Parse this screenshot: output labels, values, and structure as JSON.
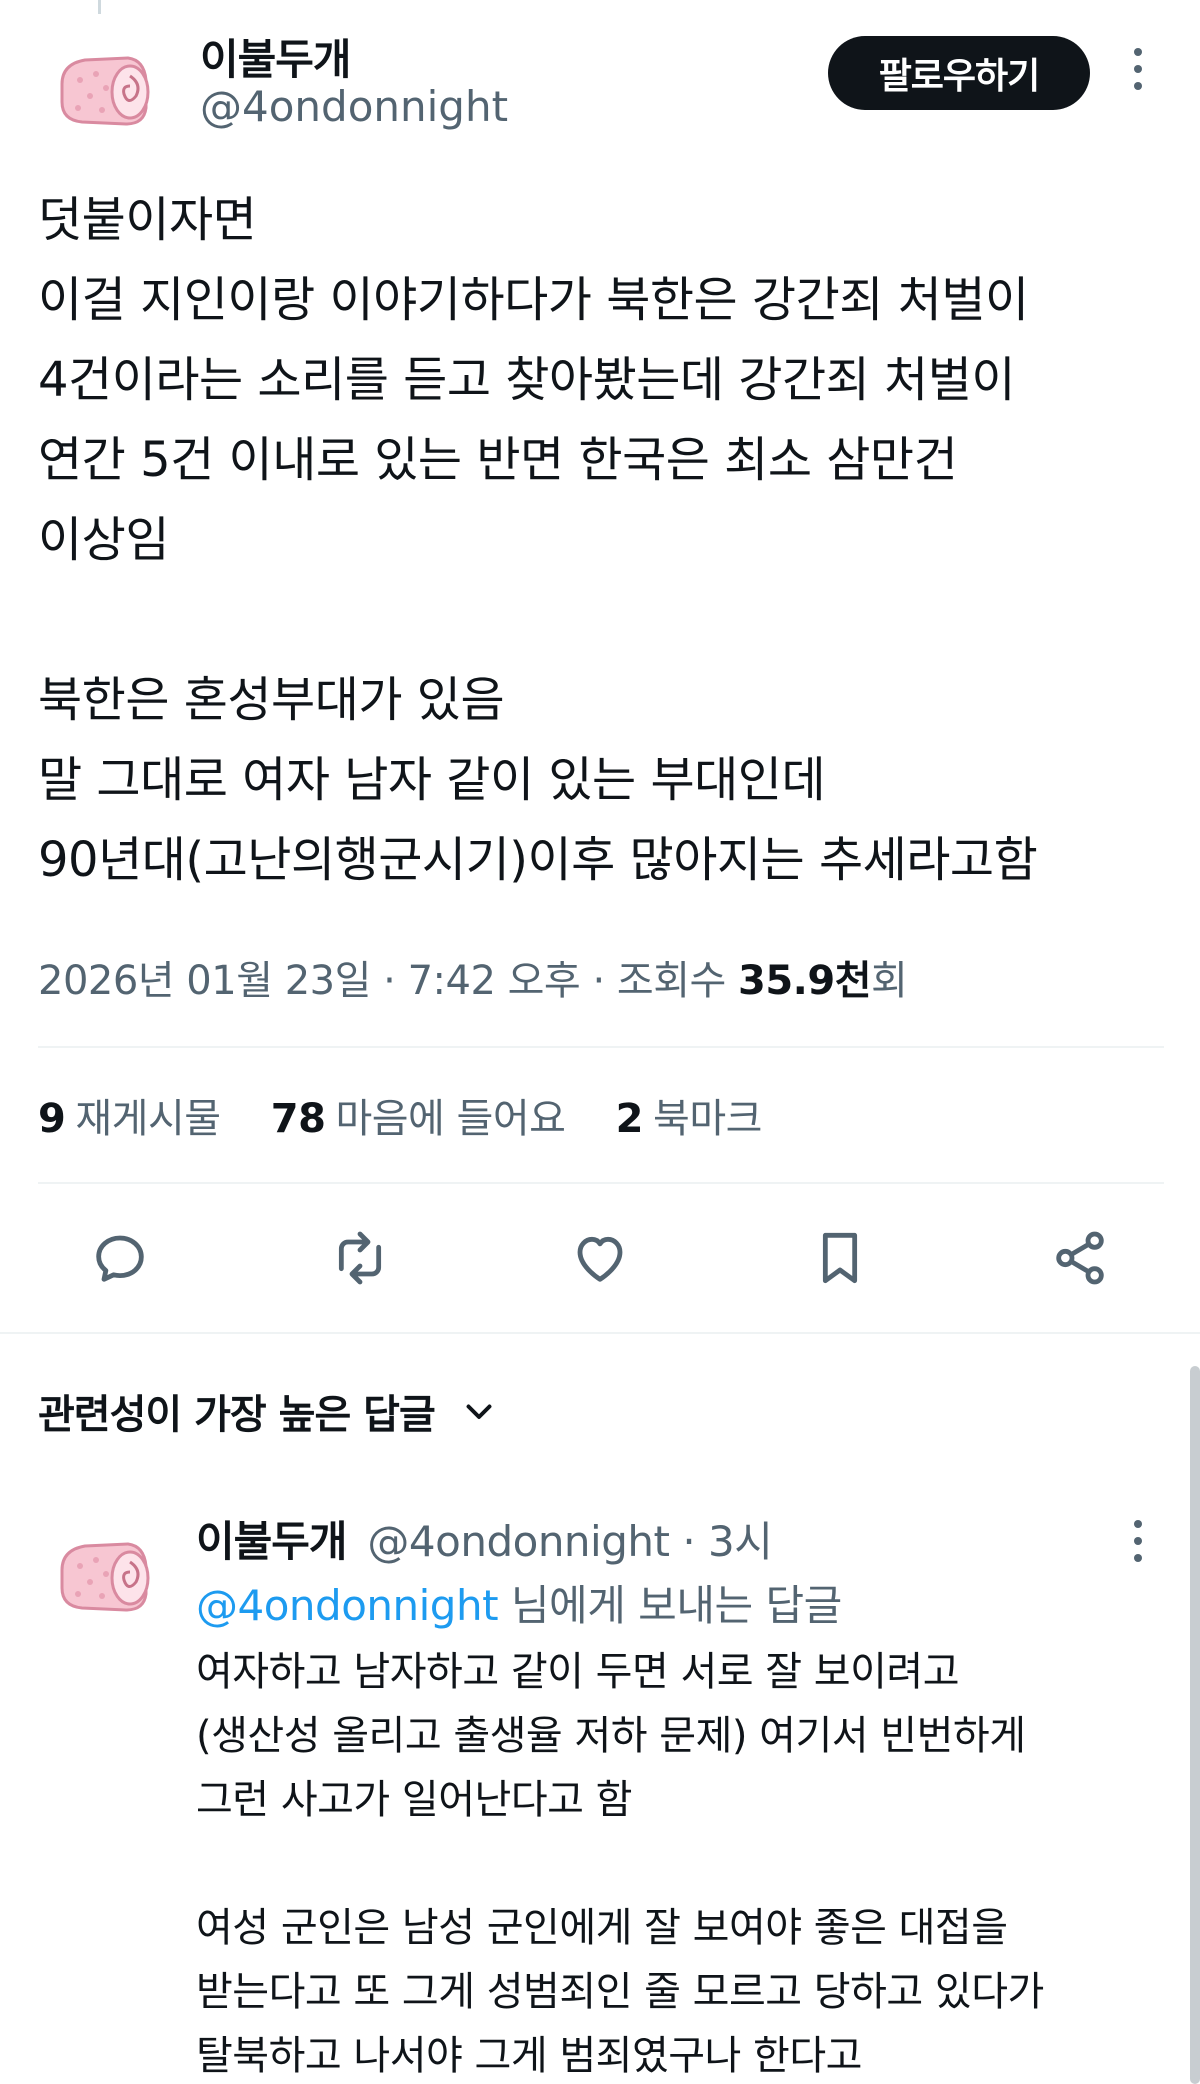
{
  "tweet": {
    "author": {
      "name": "이불두개",
      "handle": "@4ondonnight"
    },
    "follow_label": "팔로우하기",
    "lines": [
      "덧붙이자면",
      "이걸 지인이랑 이야기하다가 북한은 강간죄 처벌이",
      "4건이라는 소리를 듣고 찾아봤는데 강간죄 처벌이",
      "연간 5건 이내로 있는 반면 한국은 최소 삼만건",
      "이상임",
      "",
      "북한은 혼성부대가 있음",
      "말 그대로 여자 남자 같이 있는 부대인데",
      "90년대(고난의행군시기)이후 많아지는 추세라고함"
    ],
    "date": "2026년 01월 23일",
    "time": "7:42 오후",
    "views_label": "조회수",
    "views_value": "35.9천",
    "views_suffix": "회",
    "separator": " · "
  },
  "stats": [
    {
      "count": "9",
      "label": "재게시물"
    },
    {
      "count": "78",
      "label": "마음에 들어요"
    },
    {
      "count": "2",
      "label": "북마크"
    }
  ],
  "actions": [
    {
      "name": "reply",
      "icon": "reply-icon"
    },
    {
      "name": "repost",
      "icon": "repost-icon"
    },
    {
      "name": "like",
      "icon": "heart-icon"
    },
    {
      "name": "bookmark",
      "icon": "bookmark-icon"
    },
    {
      "name": "share",
      "icon": "share-icon"
    }
  ],
  "replies_sort": {
    "label": "관련성이 가장 높은 답글"
  },
  "reply": {
    "author": {
      "name": "이불두개",
      "handle": "@4ondonnight"
    },
    "time": "3시",
    "reply_to_mention": "@4ondonnight",
    "reply_to_suffix": " 님에게 보내는 답글",
    "lines": [
      "여자하고 남자하고 같이 두면 서로 잘 보이려고",
      "(생산성 올리고 출생율 저하 문제) 여기서 빈번하게",
      "그런 사고가 일어난다고 함",
      "",
      "여성 군인은 남성 군인에게 잘 보여야 좋은 대접을",
      "받는다고 또 그게 성범죄인 줄 모르고 당하고 있다가",
      "탈북하고 나서야 그게 범죄였구나 한다고"
    ]
  },
  "colors": {
    "text": "#0f1419",
    "secondary": "#536471",
    "accent": "#1d9bf0",
    "divider": "#eff3f4",
    "avatar_pink": "#f7c6d2"
  }
}
